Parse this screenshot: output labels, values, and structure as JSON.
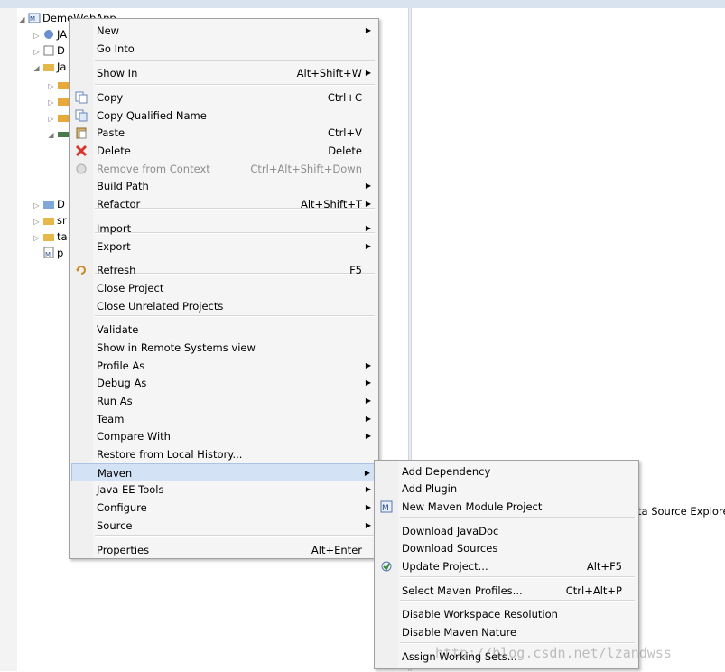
{
  "tree": {
    "project_label": "DemoWebApp",
    "rows": [
      "JA",
      "D",
      "Ja",
      "",
      "",
      "",
      "",
      "",
      "",
      "",
      "D",
      "sr",
      "ta",
      "p"
    ]
  },
  "editor": {
    "bottom_tab_label": "ta Source Explorer"
  },
  "context_menu": {
    "items": [
      {
        "label": "New",
        "accelerator": "",
        "submenu": true
      },
      {
        "label": "Go Into",
        "accelerator": "",
        "submenu": false
      },
      {
        "label": "Show In",
        "accelerator": "Alt+Shift+W",
        "submenu": true
      },
      {
        "label": "Copy",
        "accelerator": "Ctrl+C",
        "submenu": false
      },
      {
        "label": "Copy Qualified Name",
        "accelerator": "",
        "submenu": false
      },
      {
        "label": "Paste",
        "accelerator": "Ctrl+V",
        "submenu": false
      },
      {
        "label": "Delete",
        "accelerator": "Delete",
        "submenu": false
      },
      {
        "label": "Remove from Context",
        "accelerator": "Ctrl+Alt+Shift+Down",
        "submenu": false,
        "disabled": true
      },
      {
        "label": "Build Path",
        "accelerator": "",
        "submenu": true
      },
      {
        "label": "Refactor",
        "accelerator": "Alt+Shift+T",
        "submenu": true
      },
      {
        "label": "Import",
        "accelerator": "",
        "submenu": true
      },
      {
        "label": "Export",
        "accelerator": "",
        "submenu": true
      },
      {
        "label": "Refresh",
        "accelerator": "F5",
        "submenu": false
      },
      {
        "label": "Close Project",
        "accelerator": "",
        "submenu": false
      },
      {
        "label": "Close Unrelated Projects",
        "accelerator": "",
        "submenu": false
      },
      {
        "label": "Validate",
        "accelerator": "",
        "submenu": false
      },
      {
        "label": "Show in Remote Systems view",
        "accelerator": "",
        "submenu": false
      },
      {
        "label": "Profile As",
        "accelerator": "",
        "submenu": true
      },
      {
        "label": "Debug As",
        "accelerator": "",
        "submenu": true
      },
      {
        "label": "Run As",
        "accelerator": "",
        "submenu": true
      },
      {
        "label": "Team",
        "accelerator": "",
        "submenu": true
      },
      {
        "label": "Compare With",
        "accelerator": "",
        "submenu": true
      },
      {
        "label": "Restore from Local History...",
        "accelerator": "",
        "submenu": false
      },
      {
        "label": "Maven",
        "accelerator": "",
        "submenu": true,
        "highlighted": true
      },
      {
        "label": "Java EE Tools",
        "accelerator": "",
        "submenu": true
      },
      {
        "label": "Configure",
        "accelerator": "",
        "submenu": true
      },
      {
        "label": "Source",
        "accelerator": "",
        "submenu": true
      },
      {
        "label": "Properties",
        "accelerator": "Alt+Enter",
        "submenu": false
      }
    ]
  },
  "maven_submenu": {
    "items": [
      {
        "label": "Add Dependency",
        "accelerator": ""
      },
      {
        "label": "Add Plugin",
        "accelerator": ""
      },
      {
        "label": "New Maven Module Project",
        "accelerator": ""
      },
      {
        "label": "Download JavaDoc",
        "accelerator": ""
      },
      {
        "label": "Download Sources",
        "accelerator": ""
      },
      {
        "label": "Update Project...",
        "accelerator": "Alt+F5"
      },
      {
        "label": "Select Maven Profiles...",
        "accelerator": "Ctrl+Alt+P"
      },
      {
        "label": "Disable Workspace Resolution",
        "accelerator": ""
      },
      {
        "label": "Disable Maven Nature",
        "accelerator": ""
      },
      {
        "label": "Assign Working Sets...",
        "accelerator": ""
      }
    ]
  },
  "watermark": "http://blog.csdn.net/lzandwss",
  "colors": {
    "highlight": "#d3e2f5",
    "delete_icon": "#d9332b",
    "menu_bg": "#f5f5f5"
  }
}
